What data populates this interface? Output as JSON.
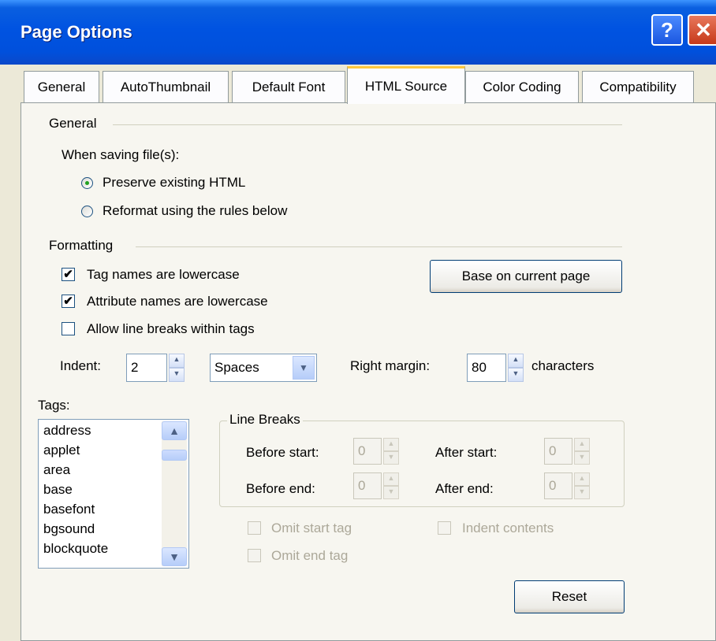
{
  "window": {
    "title": "Page Options"
  },
  "tabs": [
    "General",
    "AutoThumbnail",
    "Default Font",
    "HTML Source",
    "Color Coding",
    "Compatibility"
  ],
  "active_tab": "HTML Source",
  "general": {
    "group_label": "General",
    "saving_label": "When saving file(s):",
    "option_preserve": "Preserve existing HTML",
    "option_reformat": "Reformat using the rules below",
    "selected": "Preserve existing HTML"
  },
  "formatting": {
    "group_label": "Formatting",
    "tag_lowercase": "Tag names are lowercase",
    "attr_lowercase": "Attribute names are lowercase",
    "line_breaks_tags": "Allow line breaks within tags",
    "base_button": "Base on current page",
    "indent_label": "Indent:",
    "indent_value": "2",
    "indent_unit": "Spaces",
    "right_margin_label": "Right margin:",
    "right_margin_value": "80",
    "characters_label": "characters"
  },
  "tags": {
    "label": "Tags:",
    "items": [
      "address",
      "applet",
      "area",
      "base",
      "basefont",
      "bgsound",
      "blockquote"
    ]
  },
  "line_breaks": {
    "group_label": "Line Breaks",
    "before_start_label": "Before start:",
    "before_start_value": "0",
    "after_start_label": "After start:",
    "after_start_value": "0",
    "before_end_label": "Before end:",
    "before_end_value": "0",
    "after_end_label": "After end:",
    "after_end_value": "0"
  },
  "options": {
    "omit_start": "Omit start tag",
    "omit_end": "Omit end tag",
    "indent_contents": "Indent contents"
  },
  "buttons": {
    "reset": "Reset"
  },
  "icons": {
    "help": "?",
    "close": "✕",
    "checkmark": "✔",
    "scroll_up": "▲",
    "scroll_down": "▼",
    "spin_up": "▲",
    "spin_down": "▼",
    "dropdown": "▼"
  }
}
